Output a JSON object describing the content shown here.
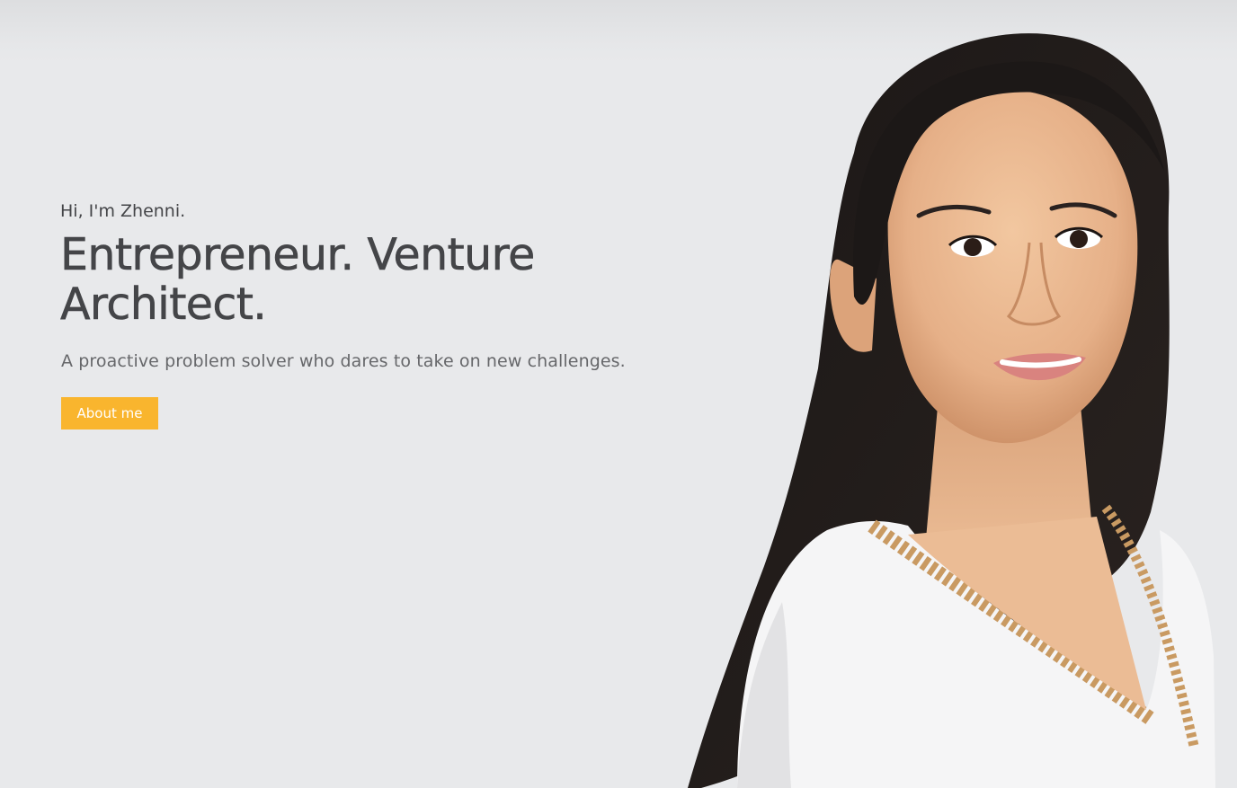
{
  "hero": {
    "greeting": "Hi, I'm Zhenni.",
    "headline_line1": "Entrepreneur. Venture",
    "headline_line2": "Architect.",
    "tagline": "A proactive problem solver who dares to take on new challenges.",
    "cta_label": "About me"
  },
  "colors": {
    "background": "#e8e9eb",
    "heading": "#444548",
    "body_text": "#66676a",
    "accent": "#f9b52e",
    "button_text": "#ffffff"
  },
  "portrait": {
    "description_icon": "portrait-photo"
  }
}
